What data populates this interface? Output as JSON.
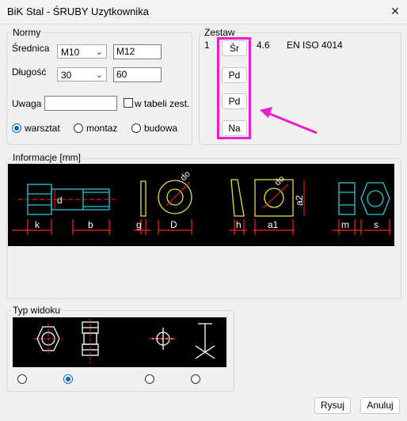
{
  "window": {
    "title": "BiK Stal - ŚRUBY Uzytkownika",
    "close_icon": "×"
  },
  "normy": {
    "group_label": "Normy",
    "srednica_label": "Średnica",
    "srednica_select": "M10",
    "srednica_input": "M12",
    "dlugosc_label": "Długość",
    "dlugosc_select": "30",
    "dlugosc_input": "60",
    "uwaga_label": "Uwaga",
    "uwaga_value": "",
    "tabela_label": "w tabeli zest.",
    "radios": [
      {
        "label": "warsztat",
        "selected": true
      },
      {
        "label": "montaz",
        "selected": false
      },
      {
        "label": "budowa",
        "selected": false
      }
    ]
  },
  "zestaw": {
    "group_label": "Zestaw",
    "row_number": "1",
    "grade": "4.6",
    "standard": "EN ISO 4014",
    "buttons": [
      "Śr",
      "Pd",
      "Pd",
      "Na"
    ],
    "highlight_color": "#e91ec8"
  },
  "informacje": {
    "group_label": "Informacje [mm]",
    "labels": {
      "d": "d",
      "k": "k",
      "b": "b",
      "g": "g",
      "do1": "do",
      "D": "D",
      "h": "h",
      "do2": "do",
      "a1": "a1",
      "a2": "a2",
      "m": "m",
      "s": "s"
    }
  },
  "typ_widoku": {
    "group_label": "Typ widoku",
    "options": [
      {
        "name": "front-bolt",
        "selected": false
      },
      {
        "name": "side-bolt",
        "selected": true
      },
      {
        "name": "symbol-cross",
        "selected": false
      },
      {
        "name": "symbol-tee",
        "selected": false
      }
    ]
  },
  "footer": {
    "rysuj": "Rysuj",
    "anuluj": "Anuluj"
  }
}
